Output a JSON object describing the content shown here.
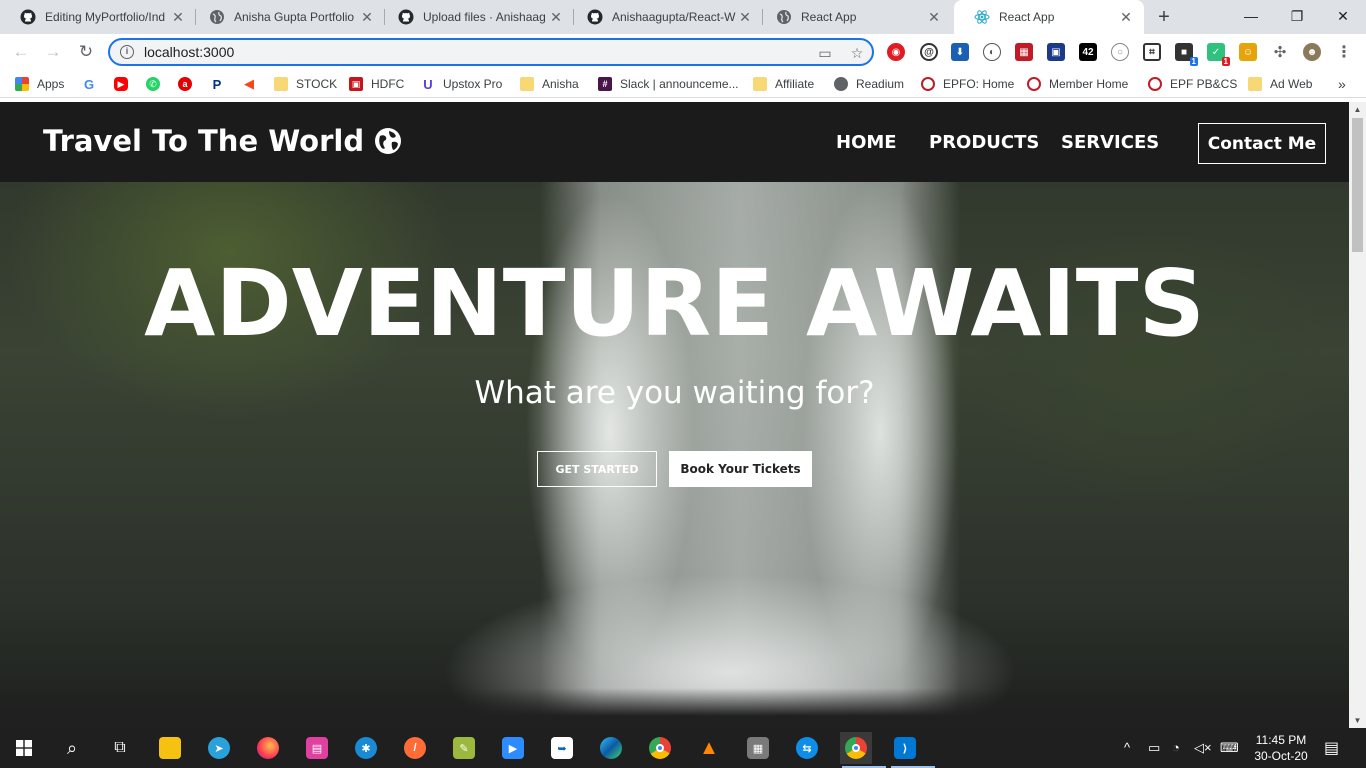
{
  "browser": {
    "tabs": [
      {
        "title": "Editing MyPortfolio/Ind",
        "icon": "github-icon"
      },
      {
        "title": "Anisha Gupta Portfolio",
        "icon": "globe-icon"
      },
      {
        "title": "Upload files · Anishaag",
        "icon": "github-icon"
      },
      {
        "title": "Anishaagupta/React-W",
        "icon": "github-icon"
      },
      {
        "title": "React App",
        "icon": "globe-icon"
      },
      {
        "title": "React App",
        "icon": "react-icon"
      }
    ],
    "url": "localhost:3000",
    "bookmarks": [
      {
        "label": "Apps"
      },
      {
        "label": "STOCK"
      },
      {
        "label": "HDFC"
      },
      {
        "label": "Upstox Pro"
      },
      {
        "label": "Anisha"
      },
      {
        "label": "Slack | announceme..."
      },
      {
        "label": "Affiliate"
      },
      {
        "label": "Readium"
      },
      {
        "label": "EPFO: Home"
      },
      {
        "label": "Member Home"
      },
      {
        "label": "EPF PB&CS"
      },
      {
        "label": "Ad Web"
      }
    ],
    "extension_badge_a": "1",
    "extension_badge_b": "1",
    "extension_42": "42",
    "colors": {
      "accent": "#1a73e8",
      "tabstrip": "#dee1e6"
    }
  },
  "site": {
    "logo_text": "Travel To The World",
    "nav": {
      "home": "HOME",
      "products": "PRODUCTS",
      "services": "SERVICES"
    },
    "contact_label": "Contact Me",
    "hero_title": "ADVENTURE AWAITS",
    "hero_subtitle": "What are you waiting for?",
    "get_started_label": "GET STARTED",
    "tickets_label": "Book Your Tickets",
    "colors": {
      "navbar": "#1c1b1b",
      "text": "#ffffff"
    }
  },
  "taskbar": {
    "time": "11:45 PM",
    "date": "30-Oct-20"
  }
}
